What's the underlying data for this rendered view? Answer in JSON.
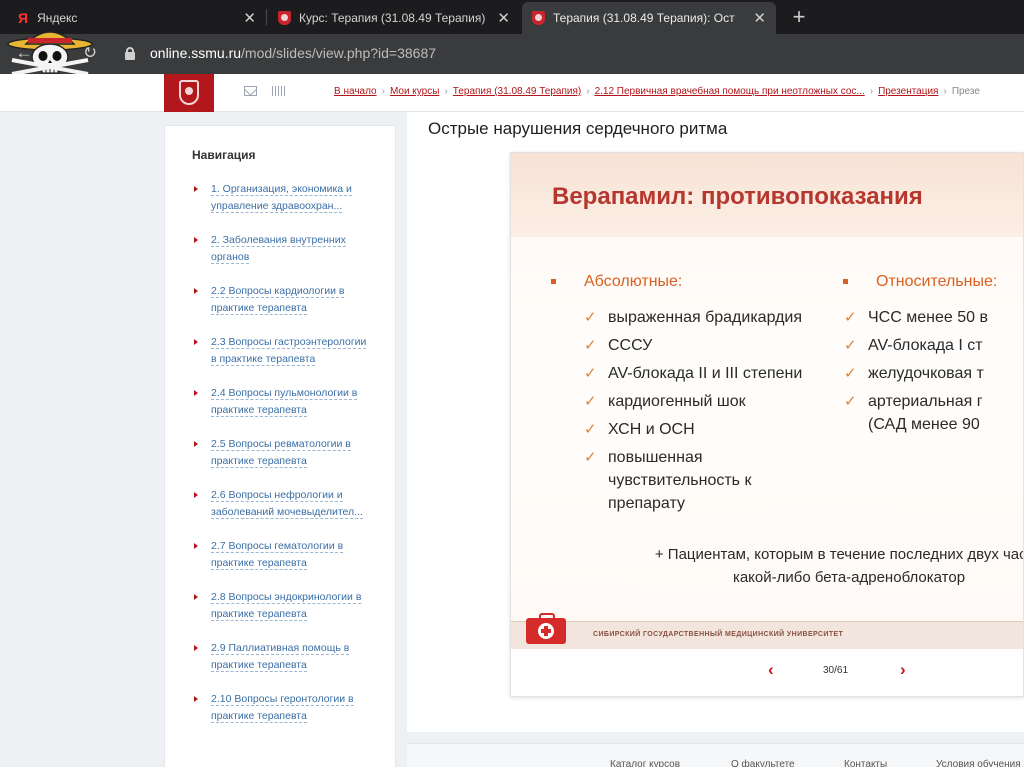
{
  "browser": {
    "tabs": [
      {
        "title": "Яндекс",
        "favicon": "yandex-icon"
      },
      {
        "title": "Курс: Терапия (31.08.49 Терапия)",
        "favicon": "ssmu-shield-icon"
      },
      {
        "title": "Терапия (31.08.49 Терапия): Ост",
        "favicon": "ssmu-shield-icon",
        "active": true
      }
    ],
    "new_tab": "+",
    "url_host": "online.ssmu.ru",
    "url_path": "/mod/slides/view.php?id=38687"
  },
  "breadcrumbs": {
    "items": [
      "В начало",
      "Мои курсы",
      "Терапия (31.08.49 Терапия)",
      "2.12 Первичная врачебная помощь при неотложных сос...",
      "Презентация"
    ],
    "current": "Презе",
    "separator": "›"
  },
  "navigation": {
    "title": "Навигация",
    "items": [
      "1. Организация, экономика и управление здравоохран...",
      "2. Заболевания внутренних органов",
      "2.2 Вопросы кардиологии в практике терапевта",
      "2.3 Вопросы гастроэнтерологии в практике терапевта",
      "2.4 Вопросы пульмонологии в практике терапевта",
      "2.5 Вопросы ревматологии в практике терапевта",
      "2.6 Вопросы нефрологии и заболеваний мочевыделител...",
      "2.7 Вопросы гематологии в практике терапевта",
      "2.8 Вопросы эндокринологии в практике терапевта",
      "2.9 Паллиативная помощь в практике терапевта",
      "2.10 Вопросы геронтологии в практике терапевта"
    ]
  },
  "page": {
    "title": "Острые нарушения сердечного ритма"
  },
  "slide": {
    "heading": "Верапамил: противопоказания",
    "absolute": {
      "title": "Абсолютные:",
      "items": [
        "выраженная брадикардия",
        "СССУ",
        "AV-блокада II и III степени",
        "кардиогенный шок",
        "ХСН и ОСН",
        "повышенная\nчувствительность к\nпрепарату"
      ]
    },
    "relative": {
      "title": "Относительные:",
      "items": [
        "ЧСС менее 50 в",
        "AV-блокада I ст",
        "желудочковая т",
        "артериальная г\n(САД менее 90"
      ]
    },
    "footnote": "+ Пациентам, которым в течение последних двух часов\nкакой-либо бета-адреноблокатор",
    "university": "СИБИРСКИЙ ГОСУДАРСТВЕННЫЙ МЕДИЦИНСКИЙ УНИВЕРСИТЕТ"
  },
  "pager": {
    "prev": "‹",
    "next": "›",
    "count": "30/61",
    "current_slide": 30,
    "total_slides": 61
  },
  "footer": {
    "links": [
      "Каталог курсов",
      "О факультете",
      "Контакты",
      "Условия обучения"
    ]
  },
  "colors": {
    "brand_red": "#b3161b",
    "slide_heading": "#b5372e",
    "slide_accent": "#d9601f",
    "link_blue": "#3a6fa6"
  }
}
